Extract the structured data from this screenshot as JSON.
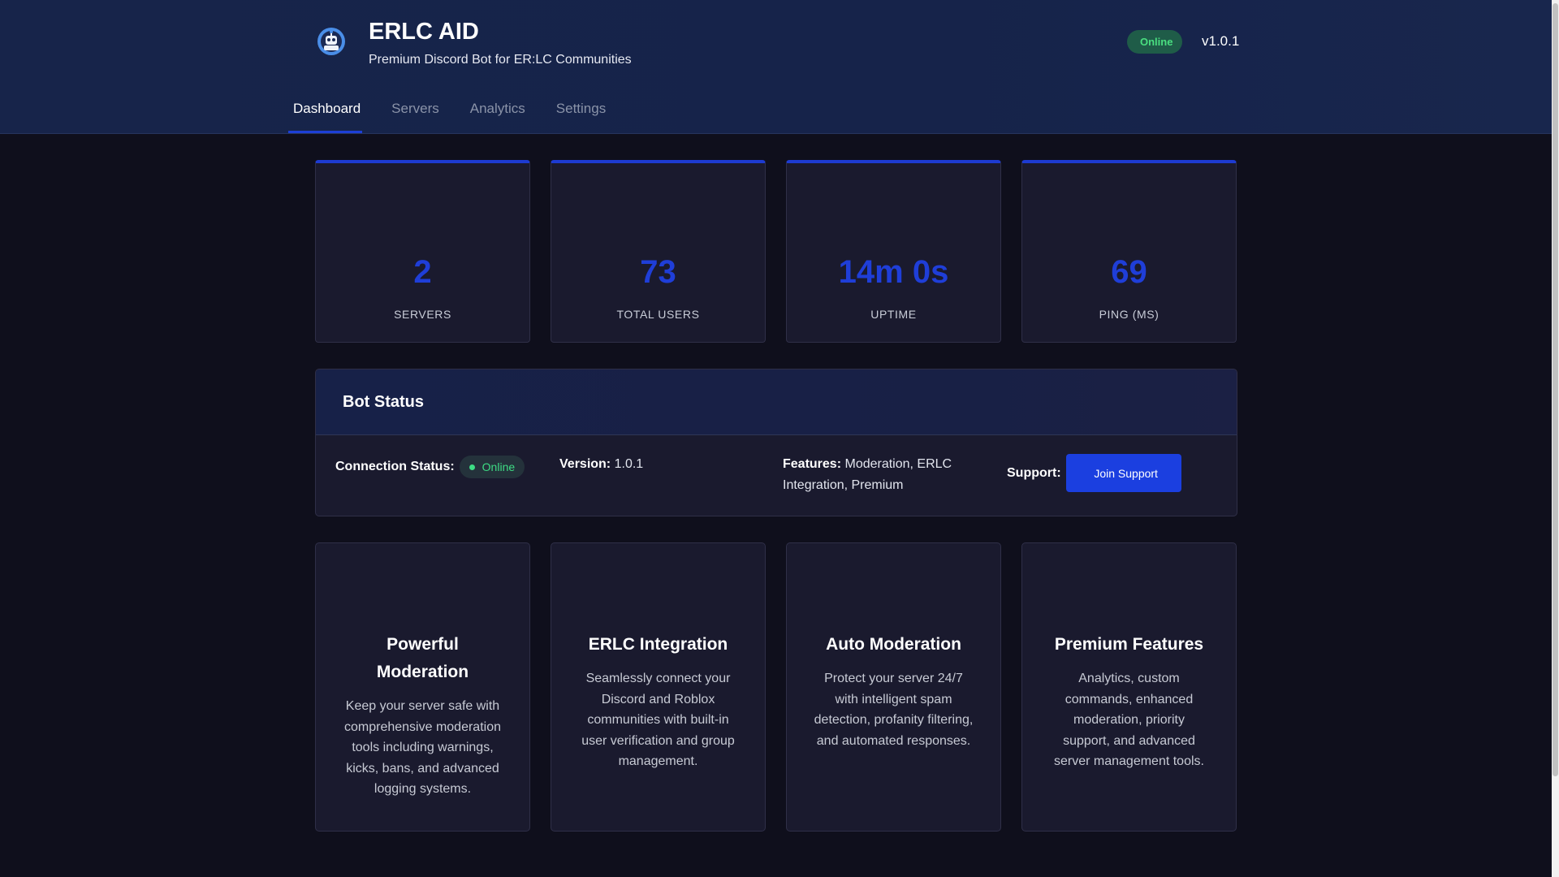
{
  "header": {
    "title": "ERLC AID",
    "subtitle": "Premium Discord Bot for ER:LC Communities",
    "status": "Online",
    "status_glyph": "",
    "version": "v1.0.1",
    "logo_icon": "robot-avatar-icon"
  },
  "nav": {
    "tabs": [
      {
        "icon": "",
        "icon_name": "dashboard-icon",
        "label": "Dashboard",
        "active": true
      },
      {
        "icon": "",
        "icon_name": "server-icon",
        "label": "Servers",
        "active": false
      },
      {
        "icon": "",
        "icon_name": "chart-icon",
        "label": "Analytics",
        "active": false
      },
      {
        "icon": "",
        "icon_name": "cog-icon",
        "label": "Settings",
        "active": false
      }
    ]
  },
  "stats": [
    {
      "icon": "",
      "icon_name": "server-icon",
      "value": "2",
      "label": "SERVERS"
    },
    {
      "icon": "",
      "icon_name": "users-icon",
      "value": "73",
      "label": "TOTAL USERS"
    },
    {
      "icon": "",
      "icon_name": "clock-icon",
      "value": "14m 0s",
      "label": "UPTIME"
    },
    {
      "icon": "",
      "icon_name": "signal-icon",
      "value": "69",
      "label": "PING (MS)"
    }
  ],
  "bot_status": {
    "icon": "",
    "icon_name": "robot-icon",
    "title": "Bot Status",
    "connection_label": "Connection Status:",
    "connection_value": "Online",
    "version_label": "Version:",
    "version_value": "1.0.1",
    "features_label": "Features:",
    "features_value": "Moderation, ERLC Integration, Premium",
    "support_label": "Support:",
    "support_button_icon": "",
    "support_button": "Join Support"
  },
  "features": [
    {
      "icon": "",
      "icon_name": "shield-icon",
      "title": "Powerful Moderation",
      "description": "Keep your server safe with comprehensive moderation tools including warnings, kicks, bans, and advanced logging systems."
    },
    {
      "icon": "",
      "icon_name": "gamepad-icon",
      "title": "ERLC Integration",
      "description": "Seamlessly connect your Discord and Roblox communities with built-in user verification and group management."
    },
    {
      "icon": "",
      "icon_name": "robot-icon",
      "title": "Auto Moderation",
      "description": "Protect your server 24/7 with intelligent spam detection, profanity filtering, and automated responses."
    },
    {
      "icon": "",
      "icon_name": "star-icon",
      "title": "Premium Features",
      "description": "Analytics, custom commands, enhanced moderation, priority support, and advanced server management tools."
    }
  ],
  "colors": {
    "accent": "#1d3fd6",
    "background": "#0f0f1c",
    "card": "#1a1a2e",
    "online_green": "#3ddc84"
  }
}
